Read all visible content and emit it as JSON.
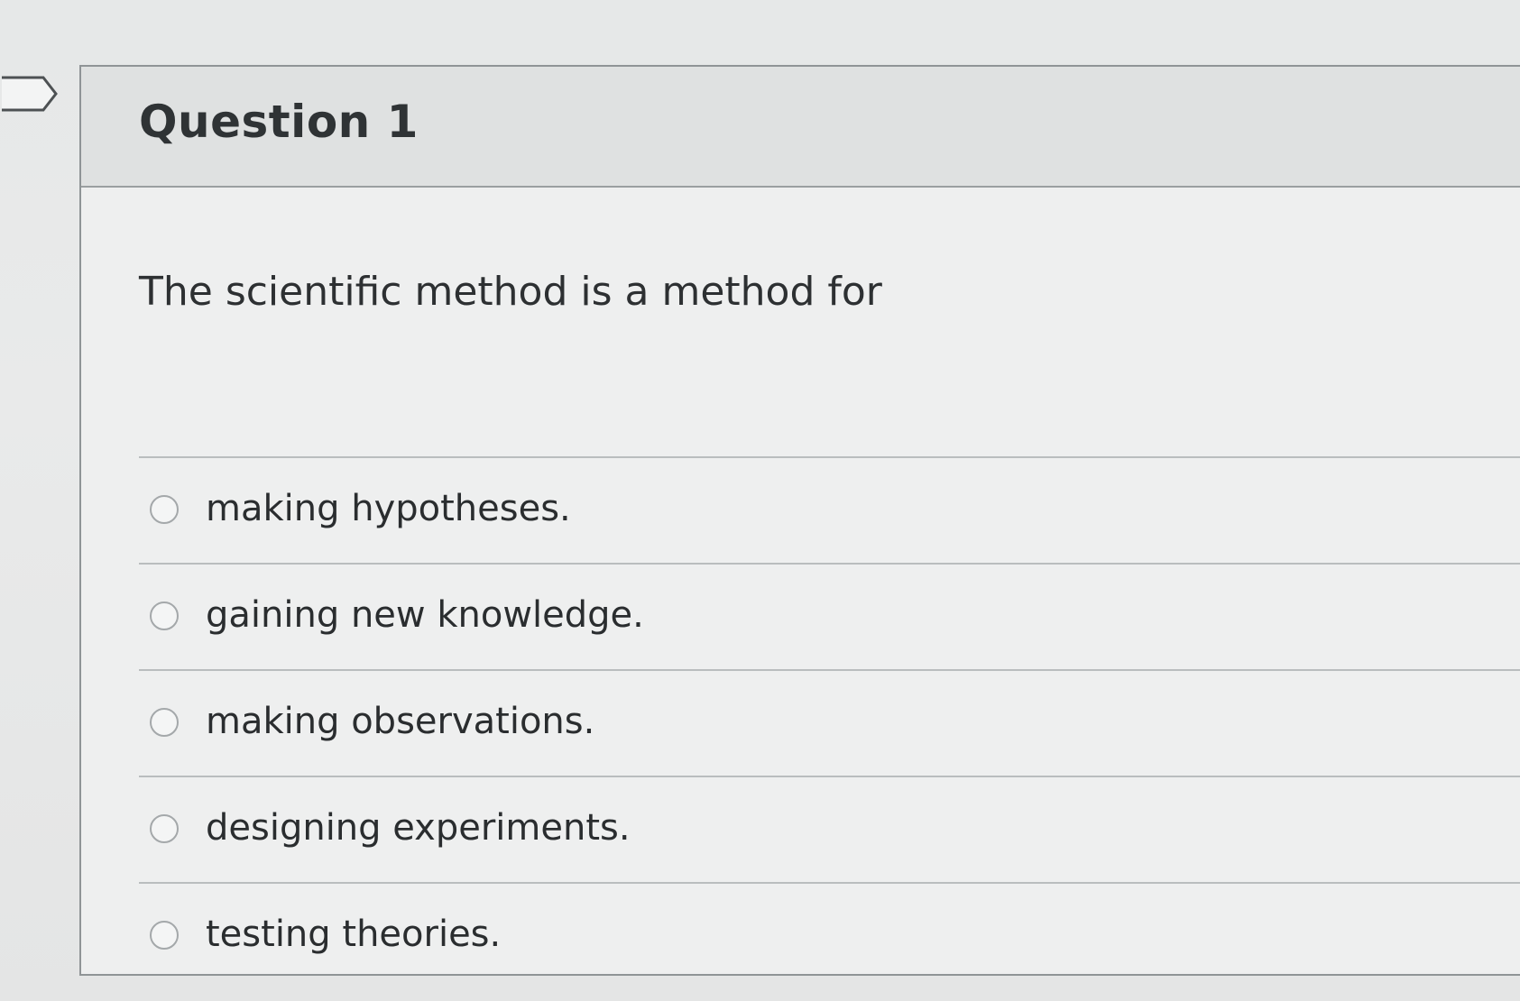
{
  "question": {
    "title": "Question 1",
    "prompt": "The scientific method is a method for",
    "answers": [
      {
        "label": "making hypotheses."
      },
      {
        "label": "gaining new knowledge."
      },
      {
        "label": "making observations."
      },
      {
        "label": "designing experiments."
      },
      {
        "label": "testing theories."
      }
    ]
  },
  "icons": {
    "bookmark": "bookmark-flag-icon",
    "radio": "radio-unselected-icon"
  },
  "colors": {
    "header_bg": "#dfe1e1",
    "card_bg": "#eeefef",
    "border": "#8f9496",
    "text": "#2d3032"
  }
}
